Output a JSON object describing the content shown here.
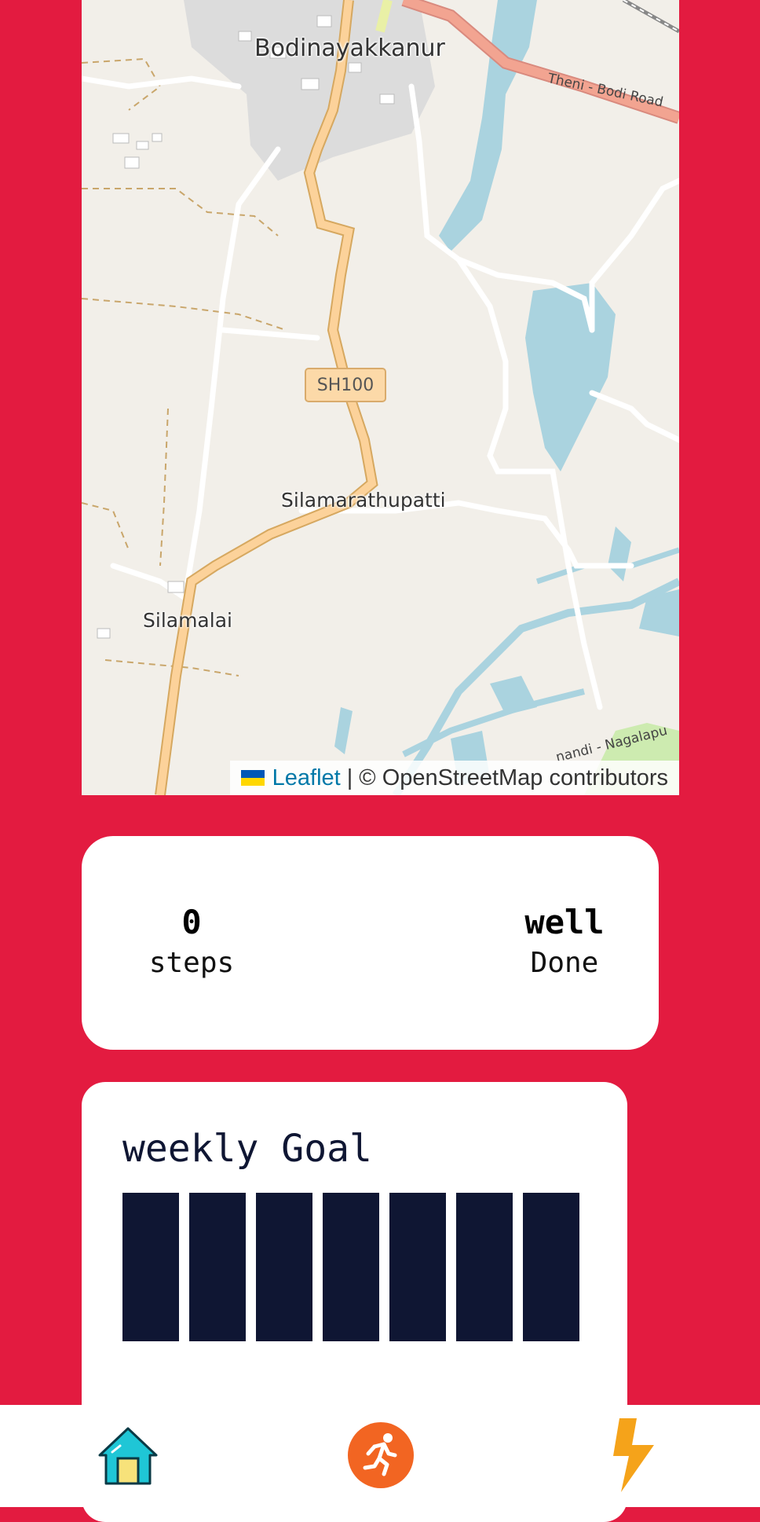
{
  "map": {
    "labels": {
      "town": "Bodinayakkanur",
      "village1": "Silamarathupatti",
      "village2": "Silamalai"
    },
    "road_shield": "SH100",
    "road_names": {
      "theni_bodi": "Theni - Bodi Road",
      "nagalapu": "nandi - Nagalapu"
    },
    "attribution": {
      "leaflet": "Leaflet",
      "separator": "|",
      "osm": "© OpenStreetMap contributors"
    }
  },
  "stats": {
    "steps": {
      "value": "0",
      "label": "steps"
    },
    "done": {
      "value": "well",
      "label": "Done"
    }
  },
  "weekly_goal": {
    "title": "weekly Goal",
    "days": 7,
    "bar_color": "#0f1633"
  },
  "nav": {
    "items": [
      {
        "name": "home",
        "icon": "home-icon"
      },
      {
        "name": "run",
        "icon": "running-icon"
      },
      {
        "name": "power",
        "icon": "lightning-icon"
      }
    ]
  },
  "colors": {
    "background": "#e31b40",
    "card": "#ffffff",
    "accent_orange": "#f26522",
    "accent_yellow": "#f5a31a"
  }
}
